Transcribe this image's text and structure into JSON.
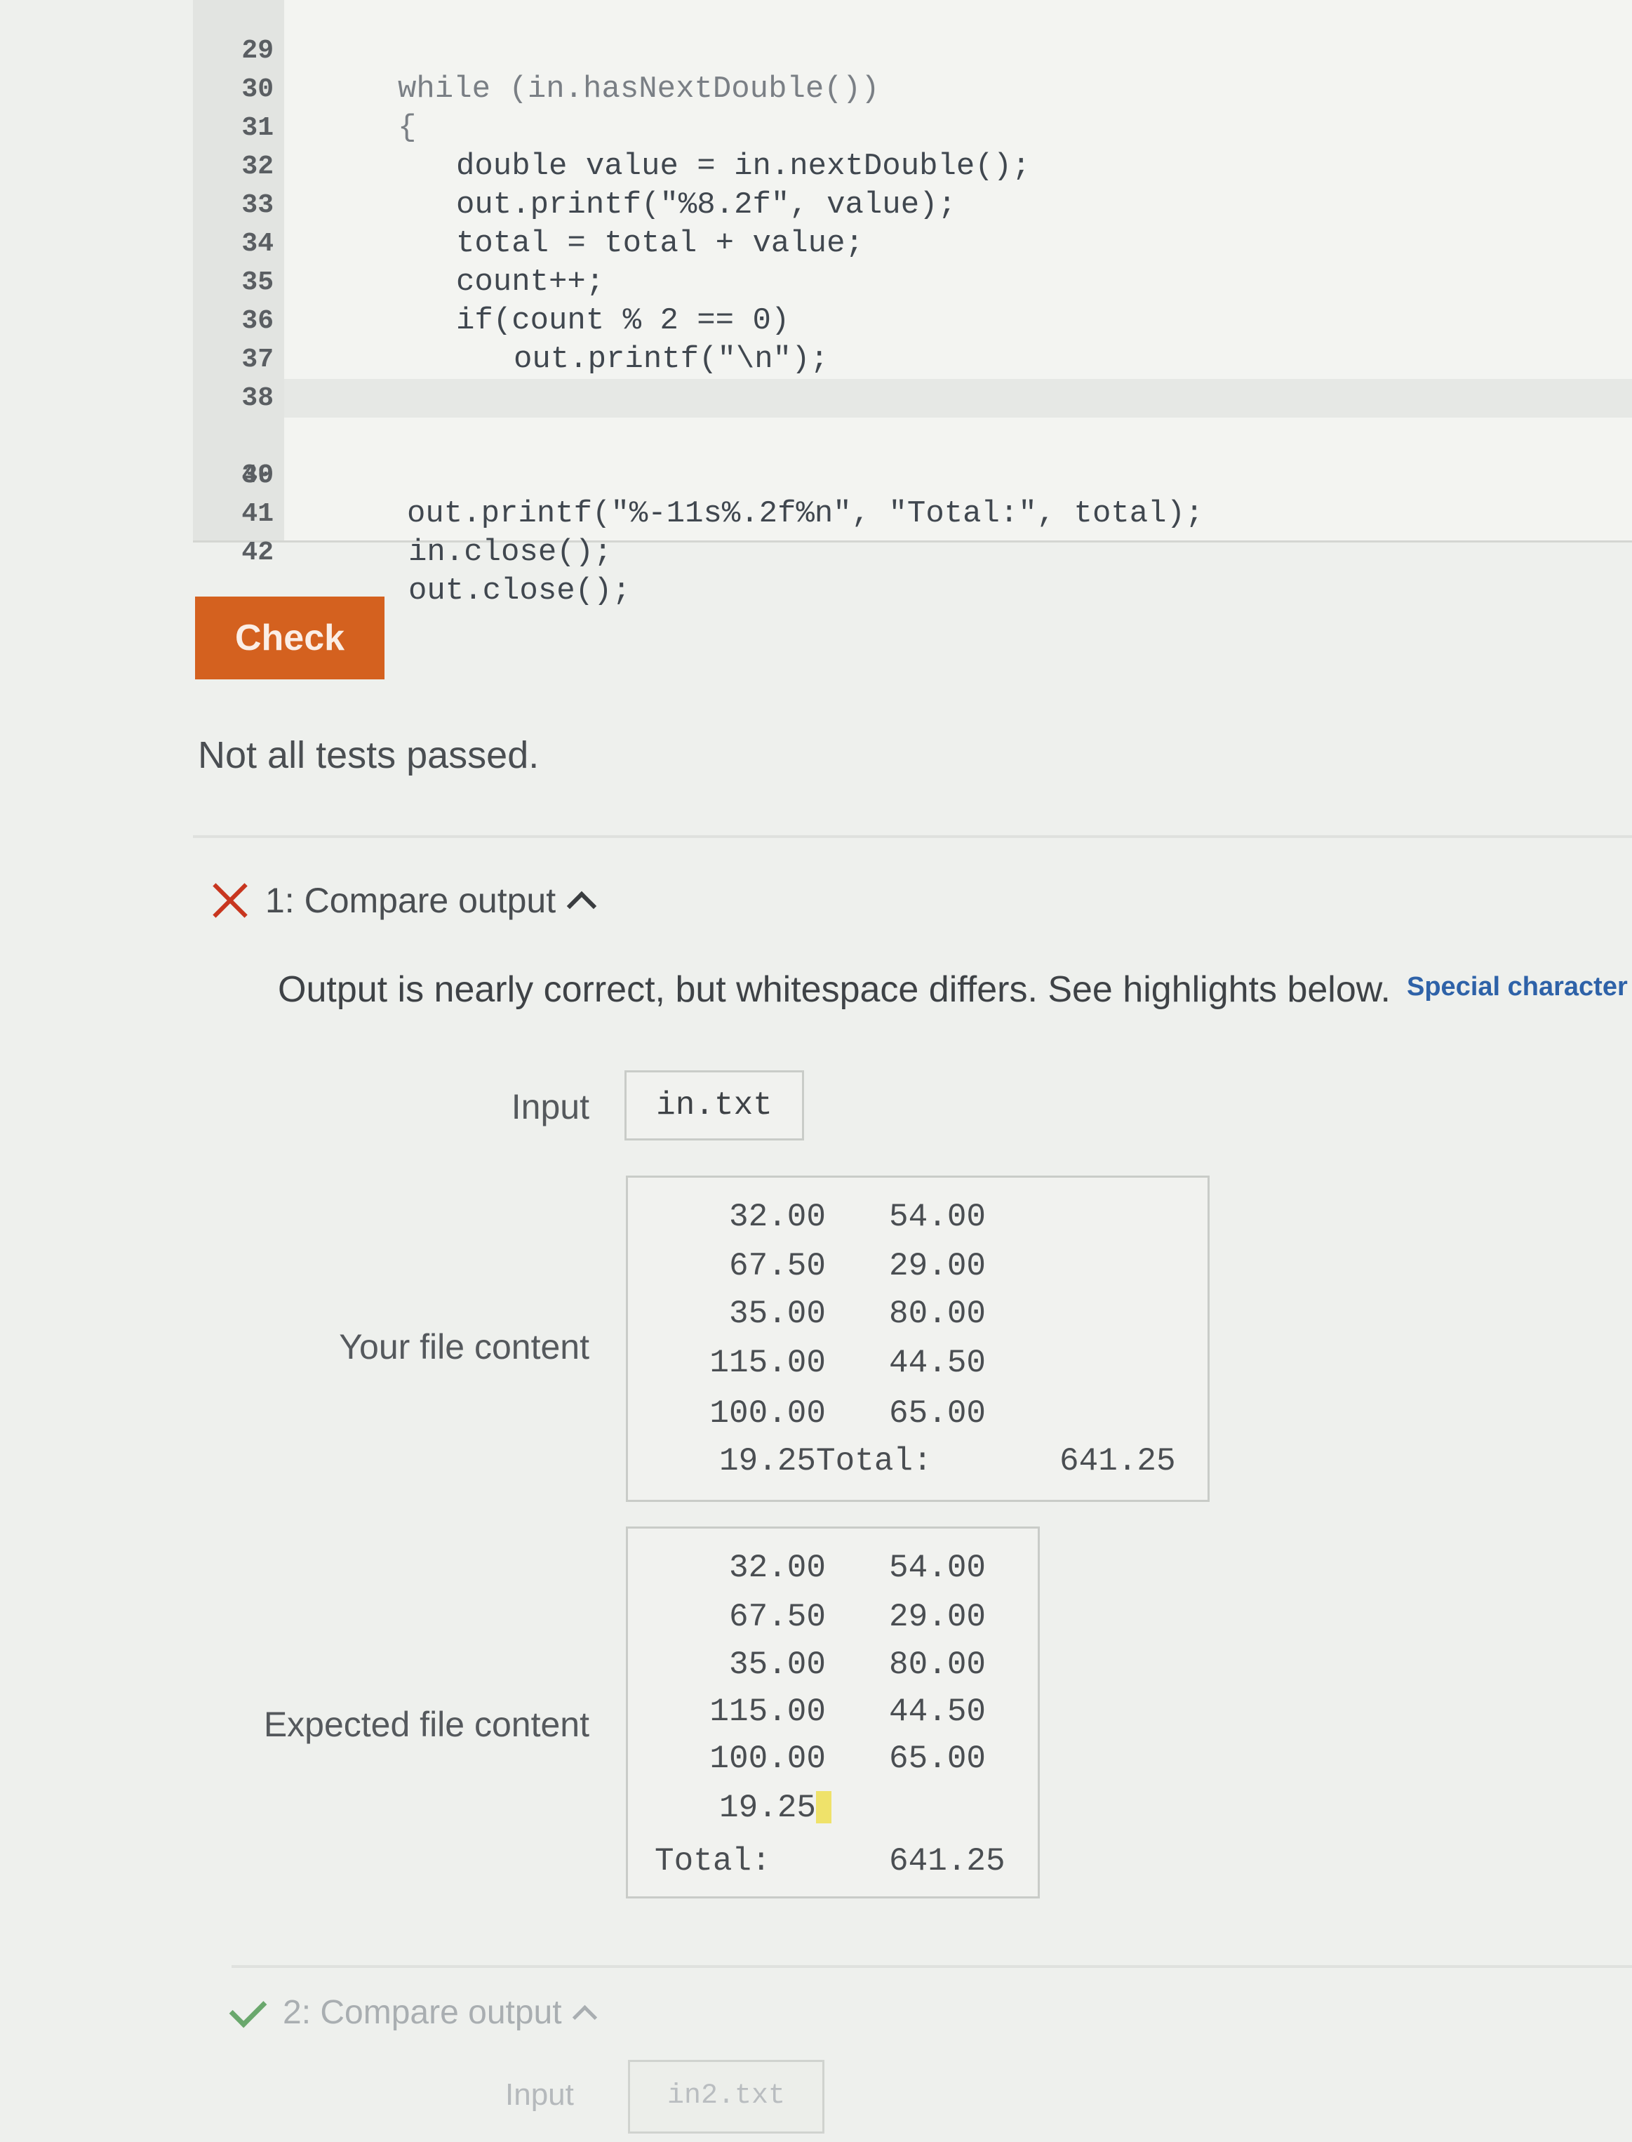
{
  "editor": {
    "lines": [
      {
        "num": "29",
        "code": "while (in.hasNextDouble())"
      },
      {
        "num": "30",
        "code": "{"
      },
      {
        "num": "31",
        "code": "double value = in.nextDouble();"
      },
      {
        "num": "32",
        "code": "out.printf(\"%8.2f\", value);"
      },
      {
        "num": "33",
        "code": "total = total + value;"
      },
      {
        "num": "34",
        "code": "count++;"
      },
      {
        "num": "35",
        "code": "if(count % 2 == 0)"
      },
      {
        "num": "36",
        "code": "out.printf(\"\\n\");"
      },
      {
        "num": "37",
        "code": "}"
      },
      {
        "num": "38",
        "code": ""
      },
      {
        "num": "39",
        "code": "out.printf(\"%-11s%.2f%n\", \"Total:\", total);"
      },
      {
        "num": "40",
        "code": ""
      },
      {
        "num": "41",
        "code": "in.close();"
      },
      {
        "num": "42",
        "code": "out.close();"
      }
    ]
  },
  "check": {
    "button_label": "Check",
    "status": "Not all tests passed."
  },
  "test1": {
    "title": "1: Compare output",
    "message": "Output is nearly correct, but whitespace differs. See highlights below.",
    "special_link": "Special character le",
    "input_label": "Input",
    "input_value": "in.txt",
    "your_label": "Your file content",
    "your_rows": [
      [
        "32.00",
        "54.00"
      ],
      [
        "67.50",
        "29.00"
      ],
      [
        "35.00",
        "80.00"
      ],
      [
        "115.00",
        "44.50"
      ],
      [
        "100.00",
        "65.00"
      ]
    ],
    "your_last_line": "19.25Total:",
    "your_total": "641.25",
    "expected_label": "Expected file content",
    "expected_rows": [
      [
        "32.00",
        "54.00"
      ],
      [
        "67.50",
        "29.00"
      ],
      [
        "35.00",
        "80.00"
      ],
      [
        "115.00",
        "44.50"
      ],
      [
        "100.00",
        "65.00"
      ]
    ],
    "expected_last": "19.25",
    "expected_total_label": "Total:",
    "expected_total": "641.25"
  },
  "test2": {
    "title": "2: Compare output",
    "input_label": "Input",
    "input_value": "in2.txt"
  },
  "colors": {
    "check_button": "#d4611f",
    "fail": "#c8361f",
    "pass": "#6aa86d",
    "link": "#2e62a8",
    "whitespace_highlight": "#efe26a"
  }
}
